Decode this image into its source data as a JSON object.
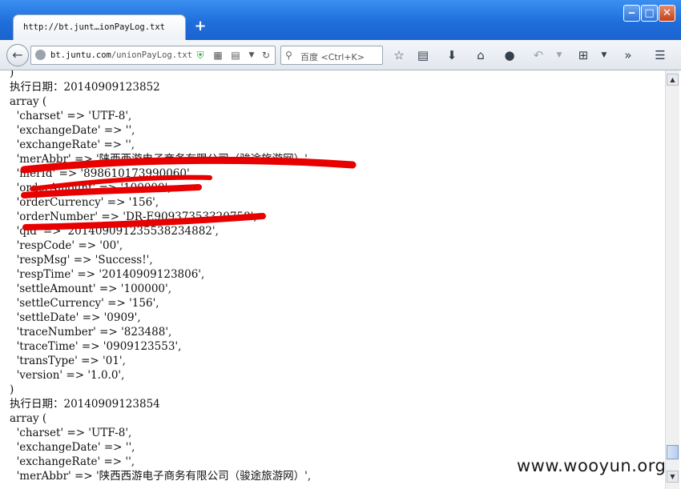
{
  "browser": {
    "tab_title": "http://bt.junt…ionPayLog.txt",
    "new_tab_label": "+",
    "window_buttons": {
      "minimize": "‒",
      "maximize": "□",
      "close": "✕"
    },
    "url": {
      "host": "bt.juntu.com",
      "path": "/unionPayLog.txt"
    },
    "search_placeholder": "百度 <Ctrl+K>",
    "icons": [
      "back-arrow-icon",
      "globe-icon",
      "shield-icon",
      "qr-code-icon",
      "reader-icon",
      "dropdown-icon",
      "reload-icon",
      "search-icon",
      "bookmark-star-icon",
      "library-icon",
      "download-icon",
      "home-icon",
      "chat-icon",
      "undo-icon",
      "crop-icon",
      "overflow-icon",
      "menu-icon"
    ]
  },
  "log_lines": [
    ")",
    "执行日期：20140909123852",
    "array (",
    "  'charset' => 'UTF-8',",
    "  'exchangeDate' => '',",
    "  'exchangeRate' => '',",
    "  'merAbbr' => '陕西西游电子商务有限公司（骏途旅游网）',",
    "  'merId' => '898610173990060',",
    "  'orderAmount' => '100000',",
    "  'orderCurrency' => '156',",
    "  'orderNumber' => 'DR-E90937353320758',",
    "  'qid' => '201409091235538234882',",
    "  'respCode' => '00',",
    "  'respMsg' => 'Success!',",
    "  'respTime' => '20140909123806',",
    "  'settleAmount' => '100000',",
    "  'settleCurrency' => '156',",
    "  'settleDate' => '0909',",
    "  'traceNumber' => '823488',",
    "  'traceTime' => '0909123553',",
    "  'transType' => '01',",
    "  'version' => '1.0.0',",
    ")",
    "执行日期：20140909123854",
    "array (",
    "  'charset' => 'UTF-8',",
    "  'exchangeDate' => '',",
    "  'exchangeRate' => '',",
    "  'merAbbr' => '陕西西游电子商务有限公司（骏途旅游网）',"
  ],
  "annotation": {
    "redaction_color": "#e80000"
  },
  "watermark": "www.wooyun.org"
}
